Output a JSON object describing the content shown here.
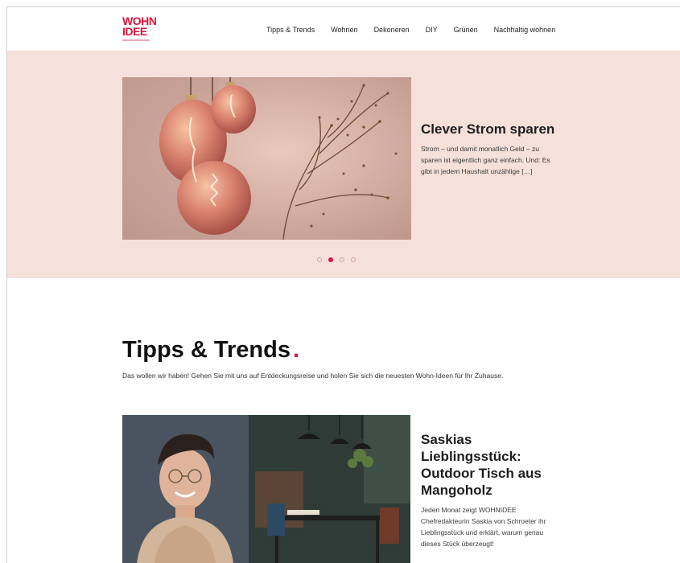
{
  "brand": {
    "logo_line1": "WOHN",
    "logo_line2": "IDEE",
    "color": "#d6173f"
  },
  "nav": {
    "items": [
      {
        "label": "Tipps & Trends"
      },
      {
        "label": "Wohnen"
      },
      {
        "label": "Dekorieren"
      },
      {
        "label": "DIY"
      },
      {
        "label": "Grünen"
      },
      {
        "label": "Nachhaltig wohnen"
      }
    ]
  },
  "hero": {
    "title": "Clever Strom sparen",
    "excerpt": "Strom – und damit monatlich Geld – zu sparen ist eigentlich ganz einfach. Und: Es gibt in jedem Haushalt unzählige […]",
    "background_color": "#f6e0da",
    "slides_total": 4,
    "active_slide": 2
  },
  "section": {
    "title": "Tipps & Trends",
    "accent": ".",
    "description": "Das wollen wir haben! Gehen Sie mit uns auf Entdeckungsreise und holen Sie sich die neuesten Wohn-Ideen für Ihr Zuhause."
  },
  "article": {
    "title": "Saskias Lieblingsstück: Outdoor Tisch aus Mangoholz",
    "excerpt": "Jeden Monat zeigt WOHNIDEE Chefredakteurin Saskia von Schroeter ihr Lieblingsstück und erklärt, warum genau dieses Stück überzeugt!"
  }
}
